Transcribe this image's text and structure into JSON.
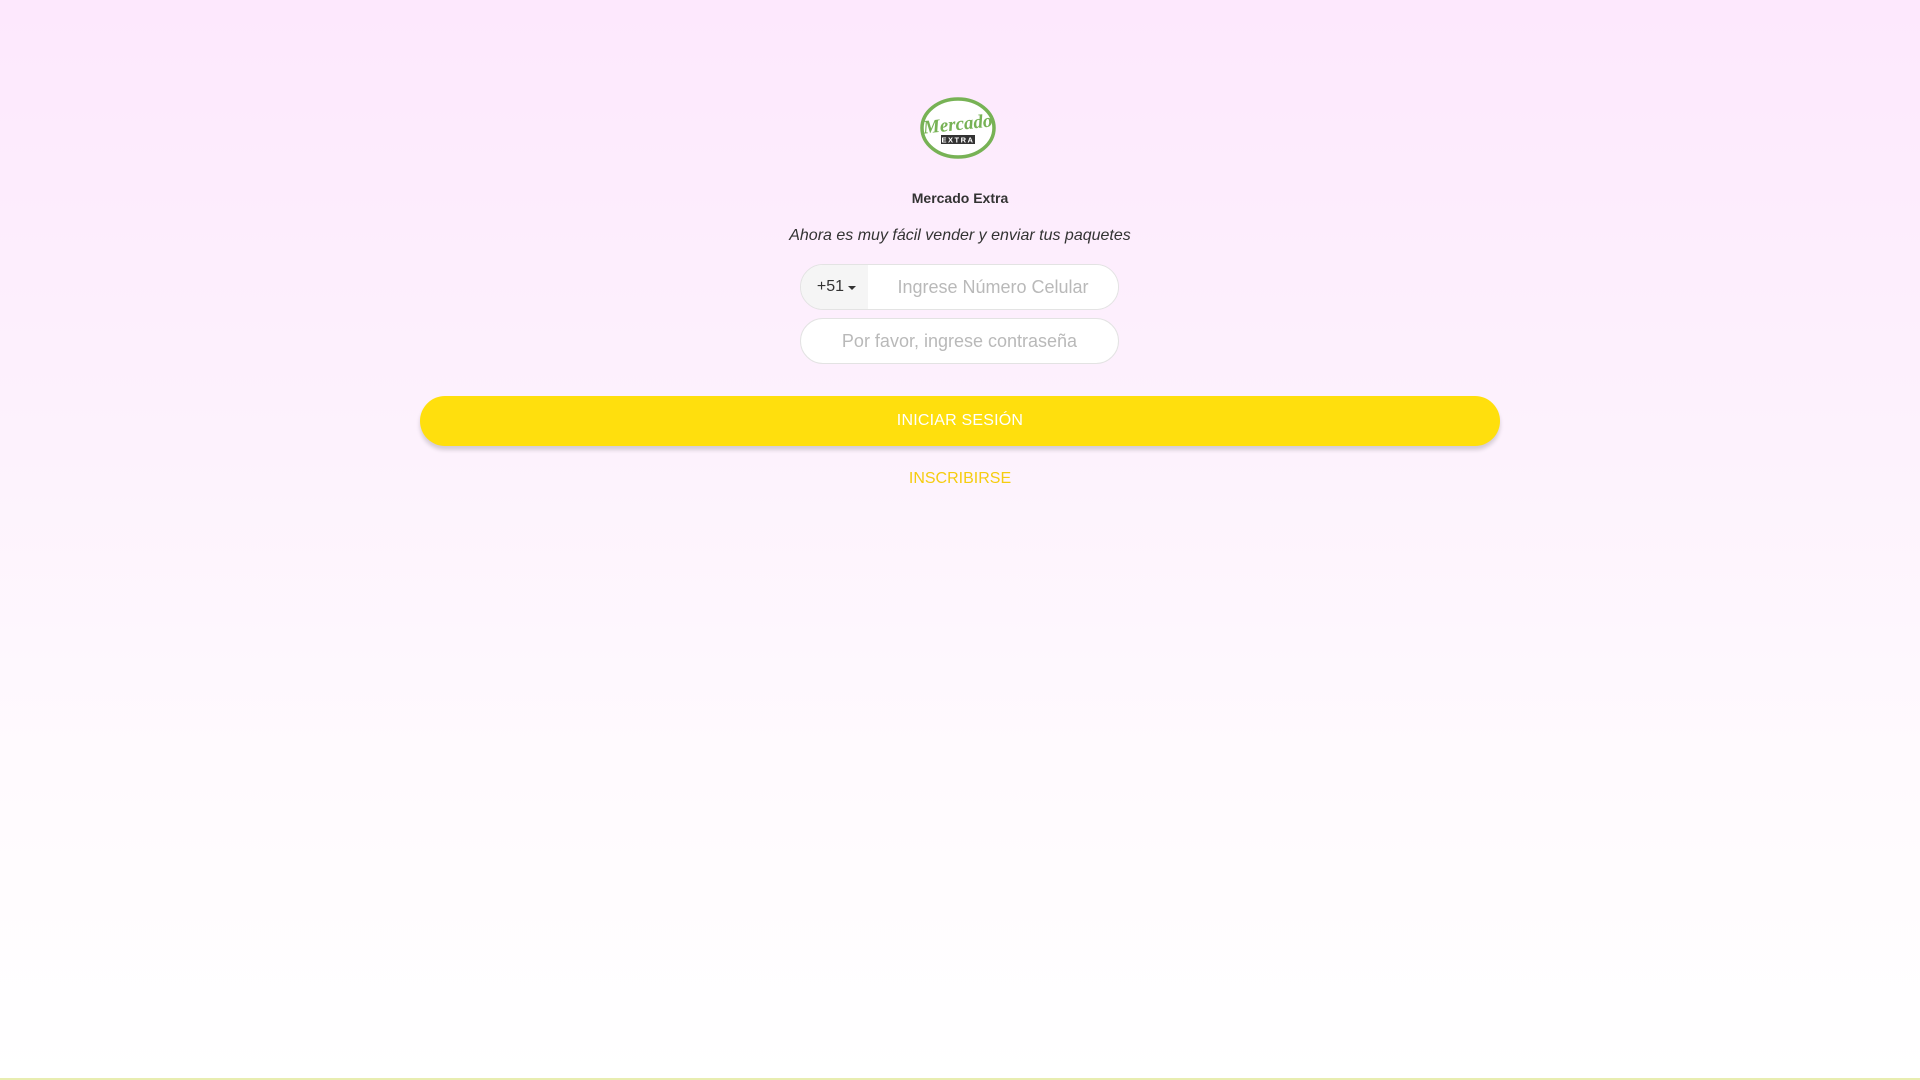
{
  "brand": {
    "logo_text": "Mercado",
    "logo_subtext": "EXTRA",
    "title": "Mercado Extra",
    "tagline": "Ahora es muy fácil vender y enviar tus paquetes",
    "logo_color": "#77b255"
  },
  "form": {
    "country_code": "+51",
    "phone_placeholder": "Ingrese Número Celular",
    "password_placeholder": "Por favor, ingrese contraseña",
    "login_label": "INICIAR SESIÓN",
    "register_label": "INSCRIBIRSE"
  },
  "colors": {
    "primary": "#ffdf0d",
    "link": "#f5cd10"
  }
}
